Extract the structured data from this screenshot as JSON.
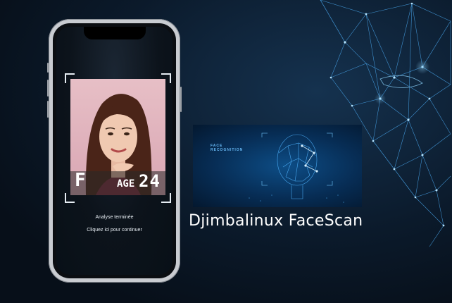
{
  "phone": {
    "result_card": {
      "gender": "F",
      "age_label": "AGE",
      "age_value": "24"
    },
    "status_title": "Analyse terminée",
    "status_action": "Cliquez ici pour continuer"
  },
  "banner": {
    "title": "FACE\nRECOGNITION"
  },
  "brand_name": "Djimbalinux FaceScan",
  "colors": {
    "background": "#0b1a2b",
    "mesh": "#4fb4ff",
    "photo_bg": "#e2b6c0",
    "banner_bg": "#0a3e70"
  }
}
